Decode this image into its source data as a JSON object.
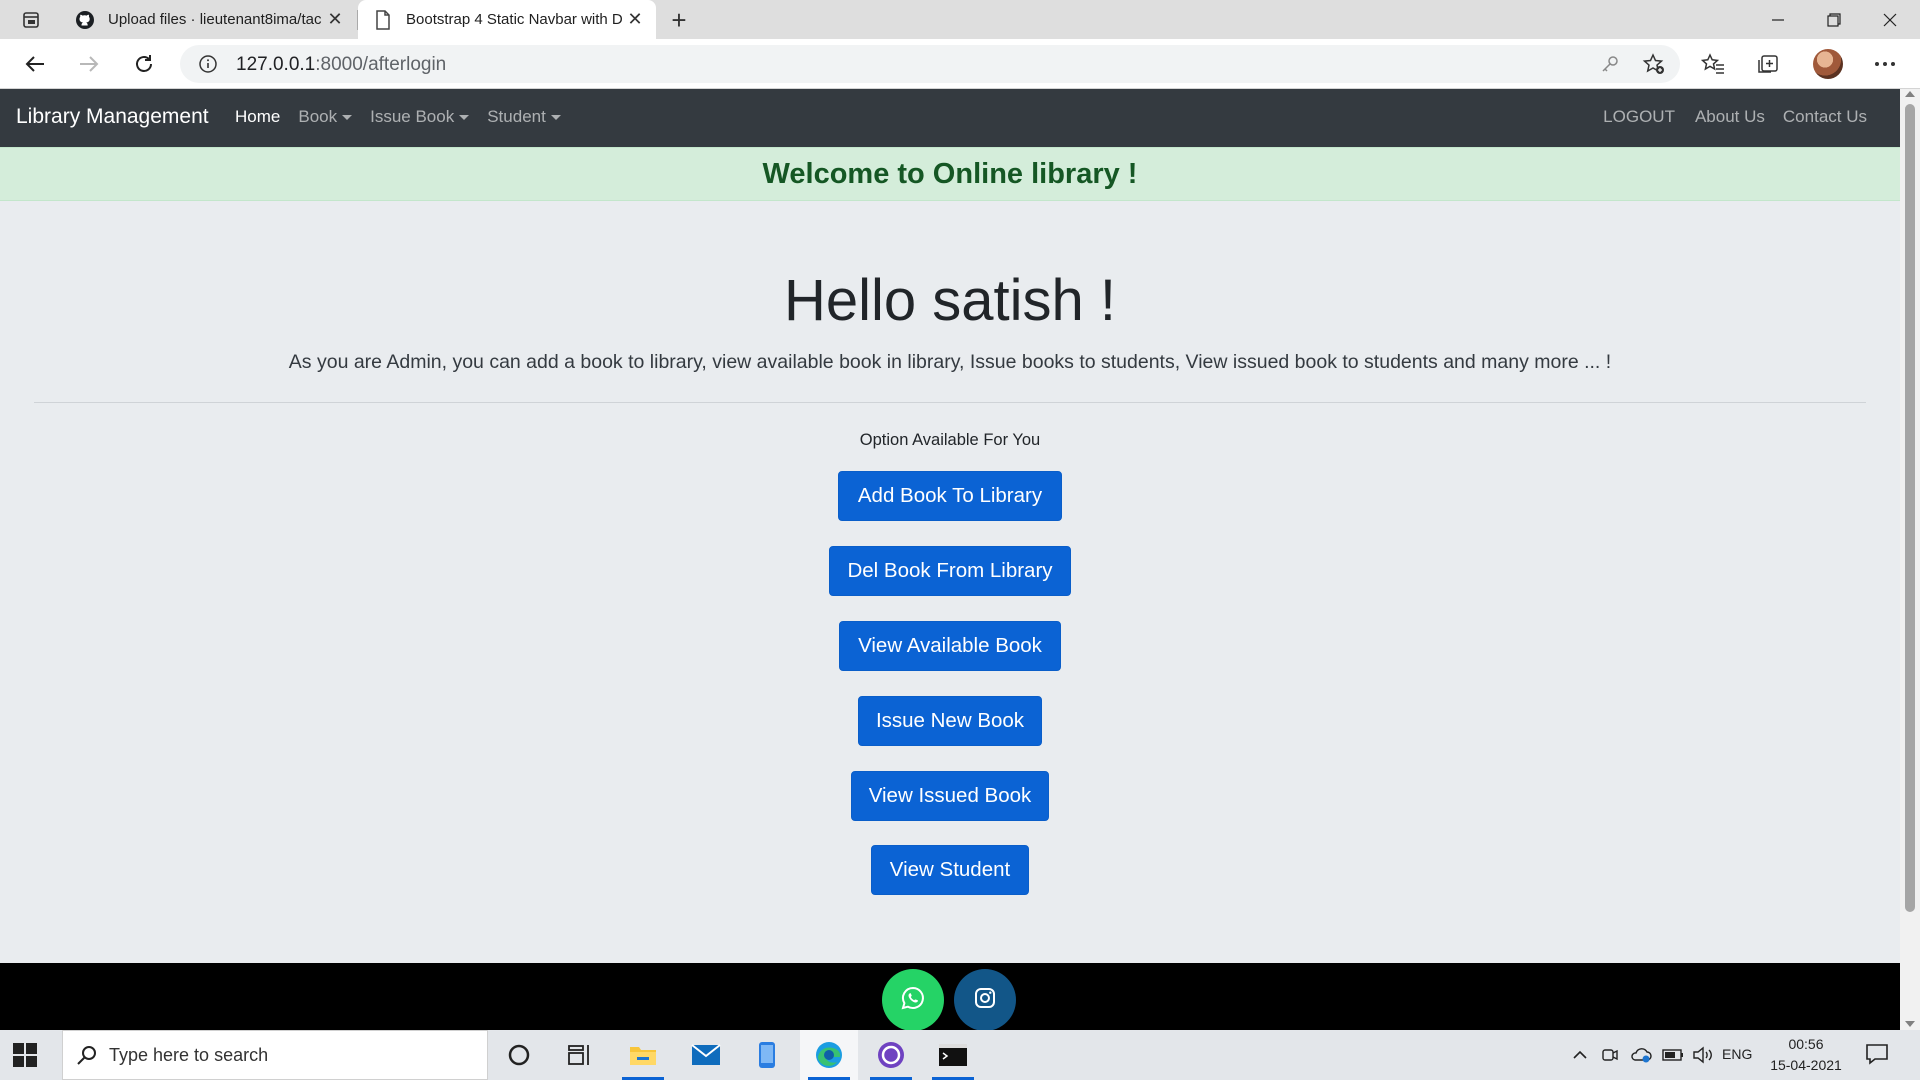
{
  "browser": {
    "tabs": [
      {
        "title": "Upload files · lieutenant8ima/tac",
        "icon": "github-icon",
        "active": false
      },
      {
        "title": "Bootstrap 4 Static Navbar with D",
        "icon": "page-icon",
        "active": true
      }
    ],
    "url_host": "127.0.0.1",
    "url_path": ":8000/afterlogin"
  },
  "navbar": {
    "brand": "Library Management",
    "left_items": [
      {
        "label": "Home",
        "active": true,
        "dropdown": false
      },
      {
        "label": "Book",
        "active": false,
        "dropdown": true
      },
      {
        "label": "Issue Book",
        "active": false,
        "dropdown": true
      },
      {
        "label": "Student",
        "active": false,
        "dropdown": true
      }
    ],
    "right_items": [
      {
        "label": "LOGOUT"
      },
      {
        "label": "About Us"
      },
      {
        "label": "Contact Us"
      }
    ]
  },
  "alert": {
    "text": "Welcome to Online library !"
  },
  "hero": {
    "title": "Hello satish !",
    "lead": "As you are Admin, you can add a book to library, view available book in library, Issue books to students, View issued book to students and many more ... !"
  },
  "options": {
    "heading": "Option Available For You",
    "buttons": [
      {
        "label": "Add Book To Library"
      },
      {
        "label": "Del Book From Library"
      },
      {
        "label": "View Available Book"
      },
      {
        "label": "Issue New Book"
      },
      {
        "label": "View Issued Book"
      },
      {
        "label": "View Student"
      }
    ]
  },
  "footer": {
    "social": [
      {
        "icon": "whatsapp-icon",
        "color": "#25d366"
      },
      {
        "icon": "instagram-icon",
        "color": "#125688"
      }
    ]
  },
  "taskbar": {
    "search_placeholder": "Type here to search",
    "language": "ENG",
    "time": "00:56",
    "date": "15-04-2021",
    "apps": [
      "cortana-icon",
      "task-view-icon",
      "file-explorer-icon",
      "mail-icon",
      "phone-icon",
      "edge-icon",
      "github-desktop-icon",
      "terminal-icon"
    ]
  },
  "colors": {
    "navbar_bg": "#343a40",
    "primary": "#0b63d4",
    "alert_bg": "#d4edda",
    "alert_text": "#155724",
    "page_bg": "#e9ecef"
  }
}
